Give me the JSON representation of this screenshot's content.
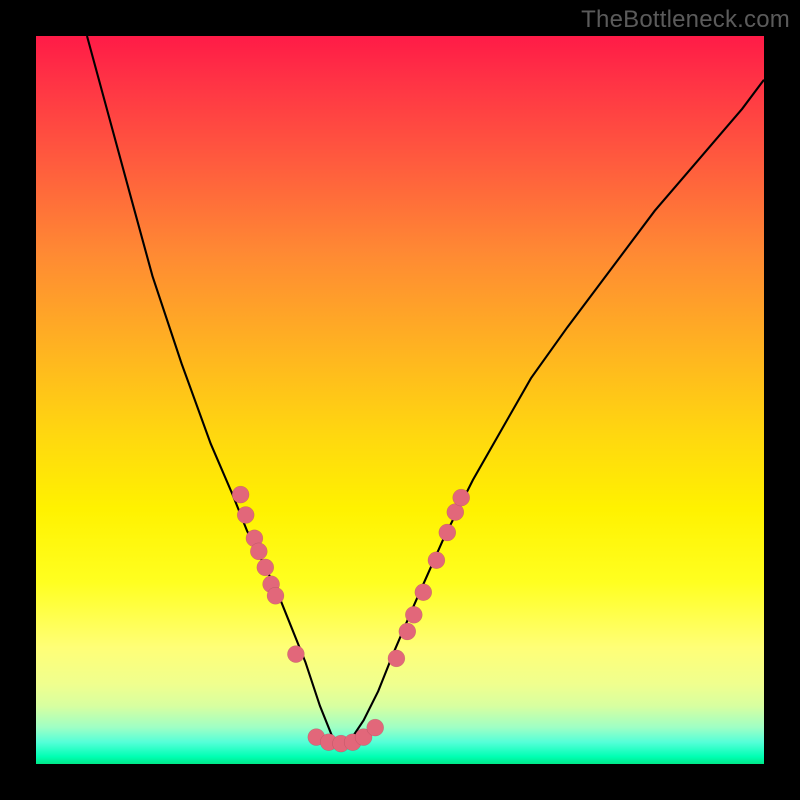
{
  "watermark": "TheBottleneck.com",
  "colors": {
    "dot_fill": "#e2677a",
    "curve_stroke": "#000000",
    "frame": "#000000"
  },
  "chart_data": {
    "type": "line",
    "title": "",
    "xlabel": "",
    "ylabel": "",
    "xlim": [
      0,
      100
    ],
    "ylim": [
      0,
      100
    ],
    "legend": false,
    "grid": false,
    "description": "V-shaped bottleneck curve with minimum near x≈41; lower values (toward bottom) are green = good, higher (toward top) are red = bad",
    "series": [
      {
        "name": "bottleneck-curve",
        "kind": "line",
        "x": [
          7,
          10,
          13,
          16,
          20,
          24,
          27,
          29,
          31,
          33,
          35,
          37,
          39,
          41,
          43,
          45,
          47,
          49,
          52,
          56,
          60,
          64,
          68,
          73,
          79,
          85,
          91,
          97,
          100
        ],
        "y": [
          100,
          89,
          78,
          67,
          55,
          44,
          37,
          32,
          28,
          24,
          19,
          14,
          8,
          3,
          3,
          6,
          10,
          15,
          22,
          31,
          39,
          46,
          53,
          60,
          68,
          76,
          83,
          90,
          94
        ]
      },
      {
        "name": "left-cluster-dots",
        "kind": "scatter",
        "x": [
          28.1,
          28.8,
          30.0,
          30.6,
          31.5,
          32.3,
          32.9,
          35.7
        ],
        "y": [
          37.0,
          34.2,
          31.0,
          29.2,
          27.0,
          24.7,
          23.1,
          15.1
        ]
      },
      {
        "name": "bottom-cluster-dots",
        "kind": "scatter",
        "x": [
          38.5,
          40.2,
          41.9,
          43.5,
          45.0,
          46.6
        ],
        "y": [
          3.7,
          3.0,
          2.8,
          3.0,
          3.7,
          5.0
        ]
      },
      {
        "name": "right-cluster-dots",
        "kind": "scatter",
        "x": [
          49.5,
          51.0,
          51.9,
          53.2,
          55.0,
          56.5,
          57.6,
          58.4
        ],
        "y": [
          14.5,
          18.2,
          20.5,
          23.6,
          28.0,
          31.8,
          34.6,
          36.6
        ]
      }
    ]
  }
}
